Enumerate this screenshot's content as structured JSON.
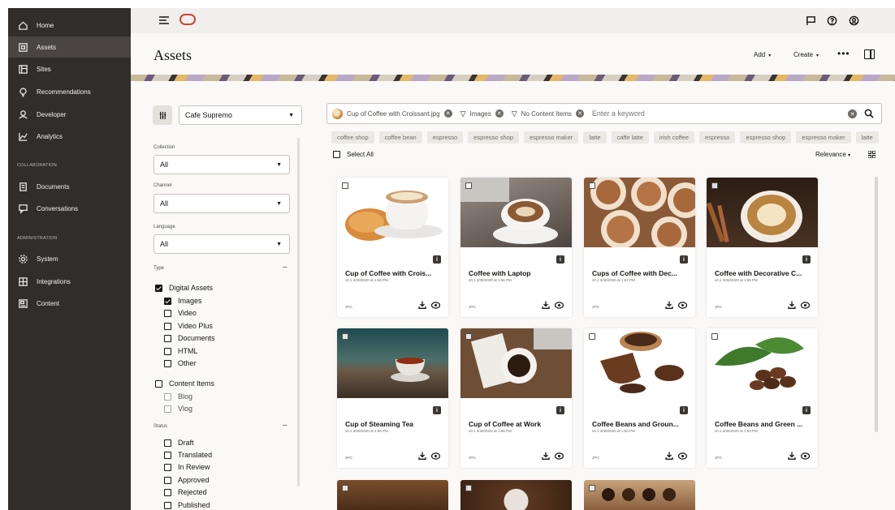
{
  "nav": {
    "items": [
      {
        "label": "Home",
        "icon": "home-icon"
      },
      {
        "label": "Assets",
        "icon": "assets-icon",
        "active": true
      },
      {
        "label": "Sites",
        "icon": "sites-icon"
      },
      {
        "label": "Recommendations",
        "icon": "lightbulb-icon"
      },
      {
        "label": "Developer",
        "icon": "developer-icon"
      },
      {
        "label": "Analytics",
        "icon": "analytics-icon"
      }
    ],
    "collaboration_label": "COLLABORATION",
    "collab_items": [
      {
        "label": "Documents",
        "icon": "documents-icon"
      },
      {
        "label": "Conversations",
        "icon": "conversations-icon"
      }
    ],
    "administration_label": "ADMINISTRATION",
    "admin_items": [
      {
        "label": "System",
        "icon": "gear-icon"
      },
      {
        "label": "Integrations",
        "icon": "integrations-icon"
      },
      {
        "label": "Content",
        "icon": "content-icon"
      }
    ]
  },
  "header": {
    "title": "Assets",
    "add_label": "Add",
    "create_label": "Create",
    "more_label": "•••"
  },
  "filters": {
    "repository": "Cafe Supremo",
    "collection_label": "Collection",
    "collection_value": "All",
    "channel_label": "Channel",
    "channel_value": "All",
    "language_label": "Language",
    "language_value": "All",
    "type_label": "Type",
    "digital_assets": "Digital Assets",
    "images": "Images",
    "video": "Video",
    "video_plus": "Video Plus",
    "documents": "Documents",
    "html": "HTML",
    "other": "Other",
    "content_items": "Content Items",
    "blog": "Blog",
    "vlog": "Vlog",
    "status_label": "Status",
    "draft": "Draft",
    "translated": "Translated",
    "in_review": "In Review",
    "approved": "Approved",
    "rejected": "Rejected",
    "published": "Published"
  },
  "search": {
    "chip_file": "Cup of Coffee with Croissant.jpg",
    "chip_images": "Images",
    "chip_no_content": "No Content Items",
    "placeholder": "Enter a keyword"
  },
  "tags": [
    "coffee shop",
    "coffee bean",
    "espresso",
    "espresso shop",
    "espresso maker",
    "latte",
    "caffe latte",
    "irish coffee",
    "espresso",
    "espresso shop",
    "espresso maker",
    "latte"
  ],
  "toolbar": {
    "select_all": "Select All",
    "sort": "Relevance"
  },
  "cards": [
    {
      "title": "Cup of Coffee with Crois...",
      "meta": "v0.1   3/30/2020 at 1:56 PM",
      "type": "JPG"
    },
    {
      "title": "Coffee with Laptop",
      "meta": "v0.1   3/30/2020 at 1:56 PM",
      "type": "JPG"
    },
    {
      "title": "Cups of Coffee with Dec...",
      "meta": "v0.1   3/30/2020 at 1:57 PM",
      "type": "JPG"
    },
    {
      "title": "Coffee with Decorative C...",
      "meta": "v0.1   3/30/2020 at 1:55 PM",
      "type": "JPG"
    },
    {
      "title": "Cup of Steaming Tea",
      "meta": "v0.1   3/30/2020 at 1:56 PM",
      "type": "JPG"
    },
    {
      "title": "Cup of Coffee at Work",
      "meta": "v0.1   3/30/2020 at 1:56 PM",
      "type": "JPG"
    },
    {
      "title": "Coffee Beans and Groun...",
      "meta": "v0.1   3/30/2020 at 1:53 PM",
      "type": "JPG"
    },
    {
      "title": "Coffee Beans and Green ...",
      "meta": "v0.1   3/30/2020 at 1:53 PM",
      "type": "JPG"
    }
  ],
  "colors": {
    "nav_bg": "#312d2a",
    "oracle_red": "#c74634"
  }
}
